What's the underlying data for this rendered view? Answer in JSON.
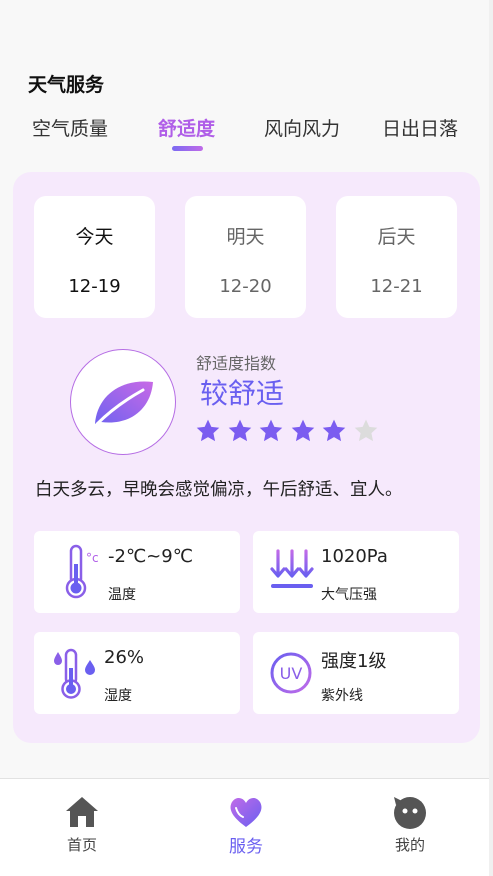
{
  "section": {
    "title": "天气服务"
  },
  "tabs": [
    {
      "label": "空气质量",
      "active": false
    },
    {
      "label": "舒适度",
      "active": true
    },
    {
      "label": "风向风力",
      "active": false
    },
    {
      "label": "日出日落",
      "active": false
    }
  ],
  "days": [
    {
      "name": "今天",
      "date": "12-19",
      "active": true
    },
    {
      "name": "明天",
      "date": "12-20",
      "active": false
    },
    {
      "name": "后天",
      "date": "12-21",
      "active": false
    }
  ],
  "comfort": {
    "index_label": "舒适度指数",
    "index_value": "较舒适",
    "rating": 5,
    "rating_max": 6,
    "description": "白天多云，早晚会感觉偏凉，午后舒适、宜人。"
  },
  "details": {
    "temperature": {
      "value": "-2℃~9℃",
      "label": "温度",
      "icon": "thermometer-icon"
    },
    "pressure": {
      "value": "1020Pa",
      "label": "大气压强",
      "icon": "pressure-arrows-icon"
    },
    "humidity": {
      "value": "26%",
      "label": "湿度",
      "icon": "humidity-thermometer-icon"
    },
    "uv": {
      "value": "强度1级",
      "label": "紫外线",
      "icon": "uv-icon",
      "icon_text": "UV"
    }
  },
  "nav": [
    {
      "label": "首页",
      "icon": "home-icon",
      "active": false
    },
    {
      "label": "服务",
      "icon": "heart-icon",
      "active": true
    },
    {
      "label": "我的",
      "icon": "profile-face-icon",
      "active": false
    }
  ],
  "colors": {
    "accent": "#6a5ff0",
    "accent_pink": "#b05ee8",
    "card_bg": "#f6e9fc",
    "star_active": "#7b5cf0",
    "star_inactive": "#dcdcdc"
  }
}
